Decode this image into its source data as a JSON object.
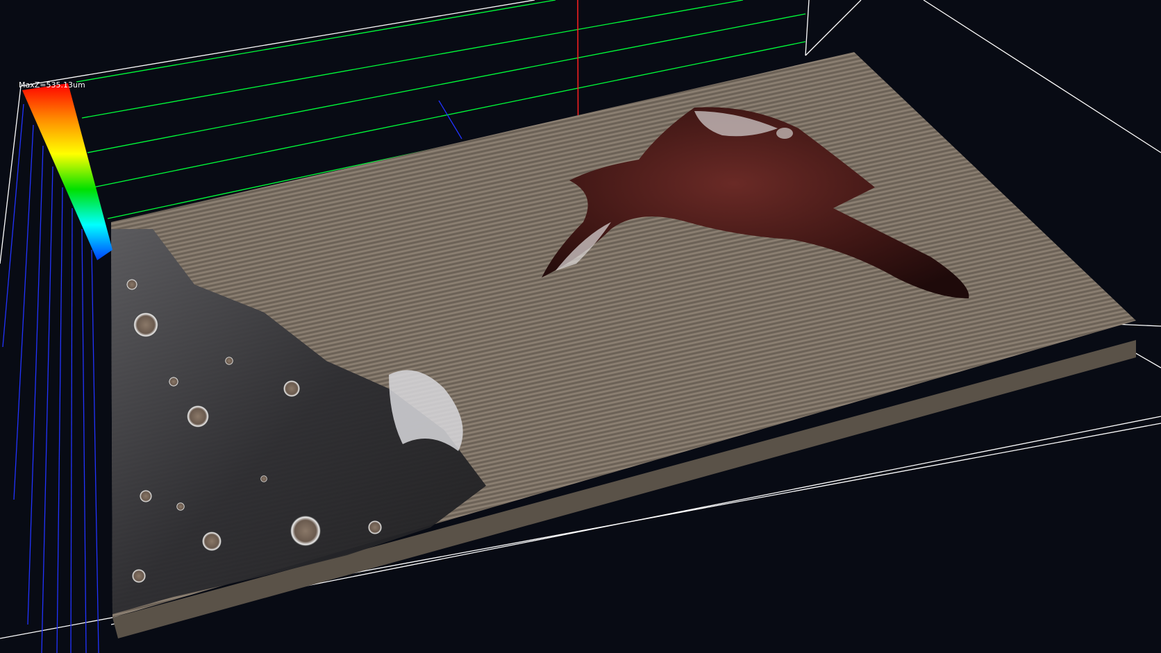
{
  "viewer": {
    "colorbar": {
      "max_label": "MaxZ=535.13um",
      "gradient": [
        "#ff0000",
        "#ff8a00",
        "#ffff00",
        "#00e000",
        "#00ffff",
        "#0040ff"
      ]
    },
    "axes": {
      "x_color": "#00ff3a",
      "y_color": "#2233ff",
      "z_color": "#ff2020",
      "box_color": "#ffffff"
    },
    "surface": {
      "base_color": "#7a6f63",
      "metal_color": "#3a3a3c",
      "droplet_color": "#4a1e1c"
    },
    "background": "#080b14"
  }
}
